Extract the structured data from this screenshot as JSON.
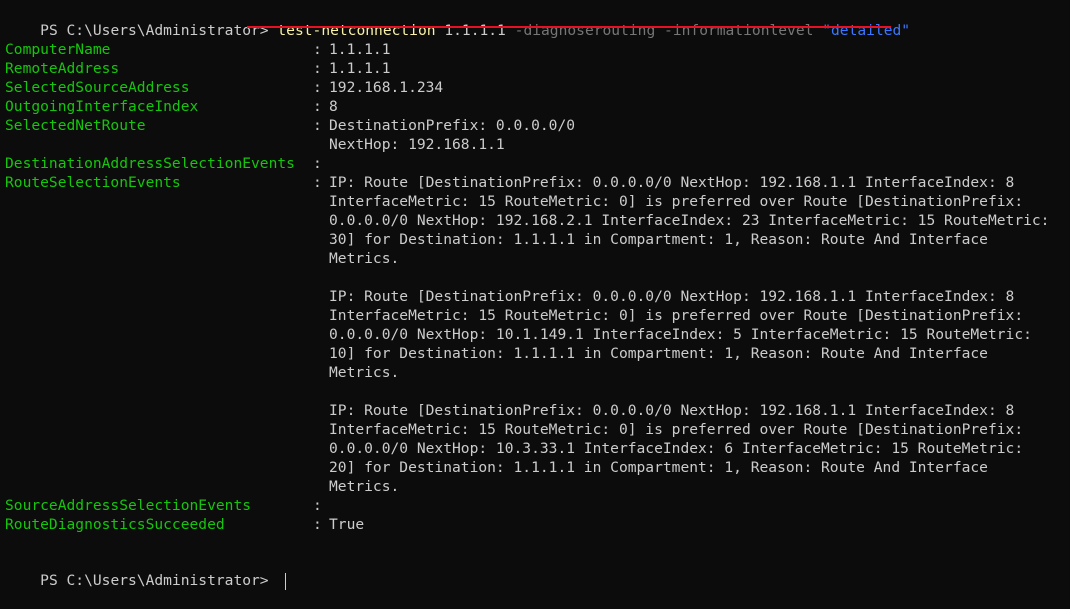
{
  "terminal": {
    "prompt": "PS C:\\Users\\Administrator> ",
    "command": {
      "name": "test-netconnection",
      "target": "1.1.1.1",
      "param1": "-diagnoserouting",
      "param2": "-informationlevel",
      "value": "\"detailed\""
    },
    "colors": {
      "background": "#0c0c0c",
      "text": "#cccccc",
      "property": "#16c60c",
      "command": "#f9f1a5",
      "parameter": "#767676",
      "string": "#3b78ff",
      "underline": "#e81123"
    },
    "properties": [
      {
        "key": "ComputerName",
        "lines": [
          "1.1.1.1"
        ]
      },
      {
        "key": "RemoteAddress",
        "lines": [
          "1.1.1.1"
        ]
      },
      {
        "key": "SelectedSourceAddress",
        "lines": [
          "192.168.1.234"
        ]
      },
      {
        "key": "OutgoingInterfaceIndex",
        "lines": [
          "8"
        ]
      },
      {
        "key": "SelectedNetRoute",
        "lines": [
          "DestinationPrefix: 0.0.0.0/0",
          "NextHop: 192.168.1.1"
        ]
      },
      {
        "key": "DestinationAddressSelectionEvents",
        "lines": []
      },
      {
        "key": "RouteSelectionEvents",
        "lines": [
          "IP: Route [DestinationPrefix: 0.0.0.0/0 NextHop: 192.168.1.1 InterfaceIndex: 8",
          "InterfaceMetric: 15 RouteMetric: 0] is preferred over Route [DestinationPrefix:",
          "0.0.0.0/0 NextHop: 192.168.2.1 InterfaceIndex: 23 InterfaceMetric: 15 RouteMetric:",
          "30] for Destination: 1.1.1.1 in Compartment: 1, Reason: Route And Interface",
          "Metrics.",
          "",
          "IP: Route [DestinationPrefix: 0.0.0.0/0 NextHop: 192.168.1.1 InterfaceIndex: 8",
          "InterfaceMetric: 15 RouteMetric: 0] is preferred over Route [DestinationPrefix:",
          "0.0.0.0/0 NextHop: 10.1.149.1 InterfaceIndex: 5 InterfaceMetric: 15 RouteMetric:",
          "10] for Destination: 1.1.1.1 in Compartment: 1, Reason: Route And Interface",
          "Metrics.",
          "",
          "IP: Route [DestinationPrefix: 0.0.0.0/0 NextHop: 192.168.1.1 InterfaceIndex: 8",
          "InterfaceMetric: 15 RouteMetric: 0] is preferred over Route [DestinationPrefix:",
          "0.0.0.0/0 NextHop: 10.3.33.1 InterfaceIndex: 6 InterfaceMetric: 15 RouteMetric:",
          "20] for Destination: 1.1.1.1 in Compartment: 1, Reason: Route And Interface",
          "Metrics."
        ]
      },
      {
        "key": "SourceAddressSelectionEvents",
        "lines": []
      },
      {
        "key": "RouteDiagnosticsSucceeded",
        "lines": [
          "True"
        ]
      }
    ],
    "separator": ":"
  }
}
